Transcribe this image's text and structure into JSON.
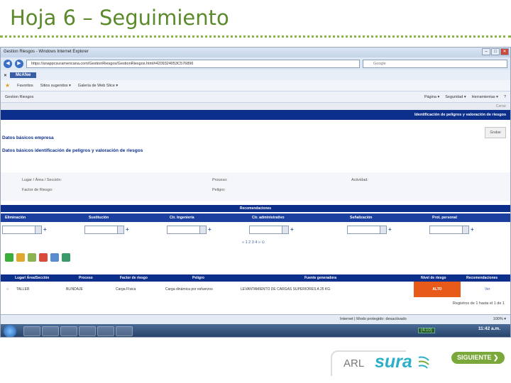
{
  "slide": {
    "title": "Hoja 6 – Seguimiento"
  },
  "browser": {
    "window_title": "Gestion Riesgos - Windows Internet Explorer",
    "address": "https://anappcsuramericana.com/GestionRiesgos/GestionRiesgos.html#4209324053C576896",
    "search_placeholder": "Google",
    "tab_label": "McAfee",
    "favorites": [
      "Favoritos",
      "Sitios sugeridos ▾",
      "Galería de Web Slice ▾"
    ],
    "page_tab": "Gestion Riesgos",
    "commands": [
      "Página ▾",
      "Seguridad ▾",
      "Herramientas ▾",
      "?"
    ],
    "close_label": "Cerrar"
  },
  "page": {
    "header": "Identificación de peligros y valoración de riesgos",
    "save_button": "Grabar",
    "section1": "Datos básicos empresa",
    "section2": "Datos básicos identificación de peligros y valoración de riesgos",
    "fields": {
      "lugar": "Lugar / Área / Sección:",
      "proceso": "Proceso:",
      "actividad": "Actividad:",
      "factor": "Factor de Riesgo:",
      "peligro": "Peligro:"
    },
    "recommendations_title": "Recomendaciones",
    "rec_columns": [
      "Eliminación",
      "Sustitución",
      "Ctr. Ingeniería",
      "Ctr. administrativo",
      "Señalización",
      "Prot. personal"
    ],
    "pager": "« 1 2 3 4 » ⊙",
    "grid_columns": [
      "Lugar/ Área/Sección",
      "Proceso",
      "Factor de riesgo",
      "Peligro",
      "Fuente generadora",
      "Nivel de riesgo",
      "Recomendaciones"
    ],
    "grid_row": {
      "lugar": "TALLER",
      "proceso": "BLINDAJE",
      "factor": "Carga Física",
      "peligro": "Carga dinámica por esfuerzos",
      "fuente": "LEVANTAMIENTO DE CARGAS SUPERIORES A 25 KG",
      "nivel": "ALTO",
      "recomendaciones": "Ver"
    },
    "registros": "Registros de 1 hasta el 1 de 1"
  },
  "statusbar": {
    "text": "Internet | Modo protegido: desactivado",
    "zoom": "100% ▾"
  },
  "taskbar": {
    "badge": "(4:10)",
    "clock": "11:42 a.m."
  },
  "brand": {
    "arl": "ARL",
    "sura": "sura",
    "next_button": "SIGUIENTE ❯"
  }
}
